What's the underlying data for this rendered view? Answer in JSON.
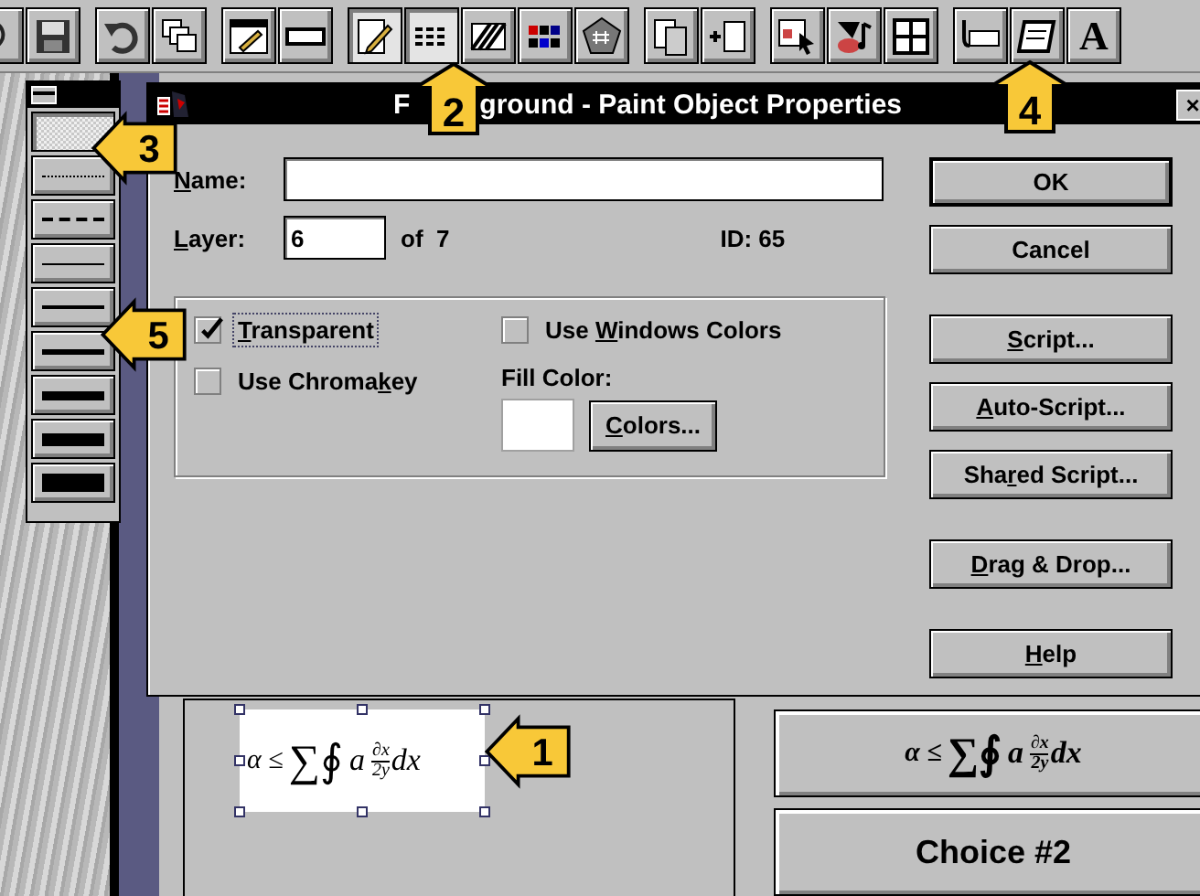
{
  "toolbar": [
    {
      "kind": "arrow",
      "pressed": false
    },
    {
      "kind": "floppy",
      "pressed": false
    },
    {
      "kind": "undo",
      "pressed": false
    },
    {
      "kind": "stack",
      "pressed": false
    },
    {
      "kind": "dialog",
      "pressed": false
    },
    {
      "kind": "bar",
      "pressed": false
    },
    {
      "kind": "pencil",
      "pressed": true
    },
    {
      "kind": "lines",
      "pressed": true
    },
    {
      "kind": "hatch",
      "pressed": false
    },
    {
      "kind": "colors",
      "pressed": false
    },
    {
      "kind": "pentagon",
      "pressed": false
    },
    {
      "kind": "pages",
      "pressed": false
    },
    {
      "kind": "newpage",
      "pressed": false
    },
    {
      "kind": "pointer",
      "pressed": false
    },
    {
      "kind": "paint",
      "pressed": false
    },
    {
      "kind": "grid",
      "pressed": false
    },
    {
      "kind": "buttontool",
      "pressed": false
    },
    {
      "kind": "scroll",
      "pressed": false
    },
    {
      "kind": "letter",
      "label": "A",
      "pressed": false
    }
  ],
  "line_palette": [
    {
      "kind": "pattern",
      "selected": true
    },
    {
      "kind": "dotted",
      "selected": false
    },
    {
      "kind": "dashed",
      "selected": false
    },
    {
      "kind": "hairline",
      "selected": false
    },
    {
      "kind": "thin",
      "selected": false
    },
    {
      "kind": "medium",
      "selected": false
    },
    {
      "kind": "thick",
      "selected": false
    },
    {
      "kind": "heavy",
      "selected": false
    },
    {
      "kind": "block",
      "selected": false
    }
  ],
  "dialog": {
    "title": [
      "F",
      "ground - Paint Object Properties"
    ],
    "close": "×",
    "name": {
      "label": {
        "key": "N",
        "post": "ame:"
      }
    },
    "layer": {
      "label": {
        "key": "L",
        "post": "ayer:"
      },
      "value": "6",
      "of": "of  7"
    },
    "id": "ID: 65",
    "options": [
      {
        "label": {
          "key": "T",
          "post": "ransparent"
        },
        "checked": true,
        "focused": true
      },
      {
        "label": {
          "pre": "Use ",
          "key": "W",
          "post": "indows Colors"
        },
        "checked": false,
        "focused": false
      },
      {
        "label": {
          "pre": "Use Chroma",
          "key": "k",
          "post": "ey"
        },
        "checked": false,
        "focused": false
      }
    ],
    "fill_color": {
      "label": "Fill Color:",
      "color": "#ffffff",
      "button": {
        "key": "C",
        "post": "olors..."
      }
    },
    "button_groups": [
      [
        {
          "label": {
            "post": "OK"
          },
          "default": true
        },
        {
          "label": {
            "post": "Cancel"
          },
          "default": false
        }
      ],
      [
        {
          "label": {
            "key": "S",
            "post": "cript..."
          },
          "default": false
        },
        {
          "label": {
            "key": "A",
            "post": "uto-Script..."
          },
          "default": false
        },
        {
          "label": {
            "pre": "Sha",
            "key": "r",
            "post": "ed Script..."
          },
          "default": false
        }
      ],
      [
        {
          "label": {
            "key": "D",
            "post": "rag & Drop..."
          },
          "default": false
        }
      ],
      [
        {
          "label": {
            "key": "H",
            "post": "elp"
          },
          "default": false
        }
      ]
    ]
  },
  "canvas": {
    "selected_object": {
      "formula": {
        "lhs": "α ≤",
        "ops": "∑∮",
        "var": "a",
        "numerator": "∂x",
        "denominator": "2y",
        "tail": "dx"
      },
      "selected": true
    },
    "choices": [
      {
        "formula": {
          "lhs": "α ≤",
          "ops": "∑∮",
          "var": "a",
          "numerator": "∂x",
          "denominator": "2y",
          "tail": "dx"
        }
      },
      {
        "label": "Choice #2"
      }
    ]
  },
  "callouts": [
    {
      "number": "1",
      "kind": "left"
    },
    {
      "number": "2",
      "kind": "up"
    },
    {
      "number": "3",
      "kind": "left"
    },
    {
      "number": "4",
      "kind": "up"
    },
    {
      "number": "5",
      "kind": "left"
    }
  ]
}
